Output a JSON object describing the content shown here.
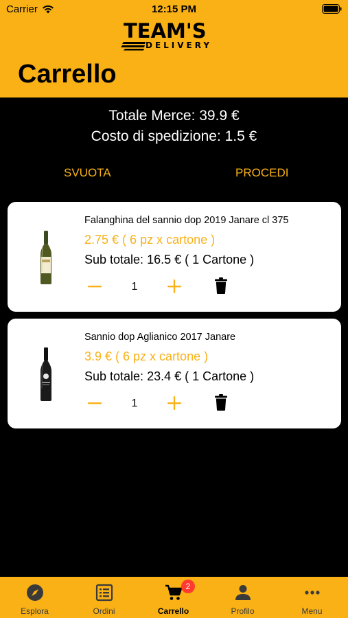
{
  "status_bar": {
    "carrier": "Carrier",
    "time": "12:15 PM"
  },
  "header": {
    "logo_top": "TEAM'S",
    "logo_bottom": "DELIVERY",
    "title": "Carrello",
    "background_color": "#F9B116"
  },
  "summary": {
    "merchandise_total": "Totale Merce: 39.9 €",
    "shipping_cost": "Costo di spedizione: 1.5 €"
  },
  "actions": {
    "empty_label": "SVUOTA",
    "proceed_label": "PROCEDI"
  },
  "accent_color": "#F9B116",
  "cart_items": [
    {
      "name": "Falanghina del sannio dop 2019 Janare cl 375",
      "price": "2.75 € ( 6 pz x cartone )",
      "subtotal": "Sub totale: 16.5 € ( 1  Cartone )",
      "quantity": "1",
      "bottle_type": "white-wine"
    },
    {
      "name": "Sannio dop Aglianico 2017 Janare",
      "price": "3.9 € ( 6 pz x cartone )",
      "subtotal": "Sub totale: 23.4 € ( 1  Cartone )",
      "quantity": "1",
      "bottle_type": "red-wine"
    }
  ],
  "tabbar": {
    "tabs": [
      {
        "label": "Esplora",
        "icon": "compass-icon"
      },
      {
        "label": "Ordini",
        "icon": "list-icon"
      },
      {
        "label": "Carrello",
        "icon": "cart-icon",
        "badge": "2",
        "active": true
      },
      {
        "label": "Profilo",
        "icon": "person-icon"
      },
      {
        "label": "Menu",
        "icon": "more-icon"
      }
    ]
  }
}
